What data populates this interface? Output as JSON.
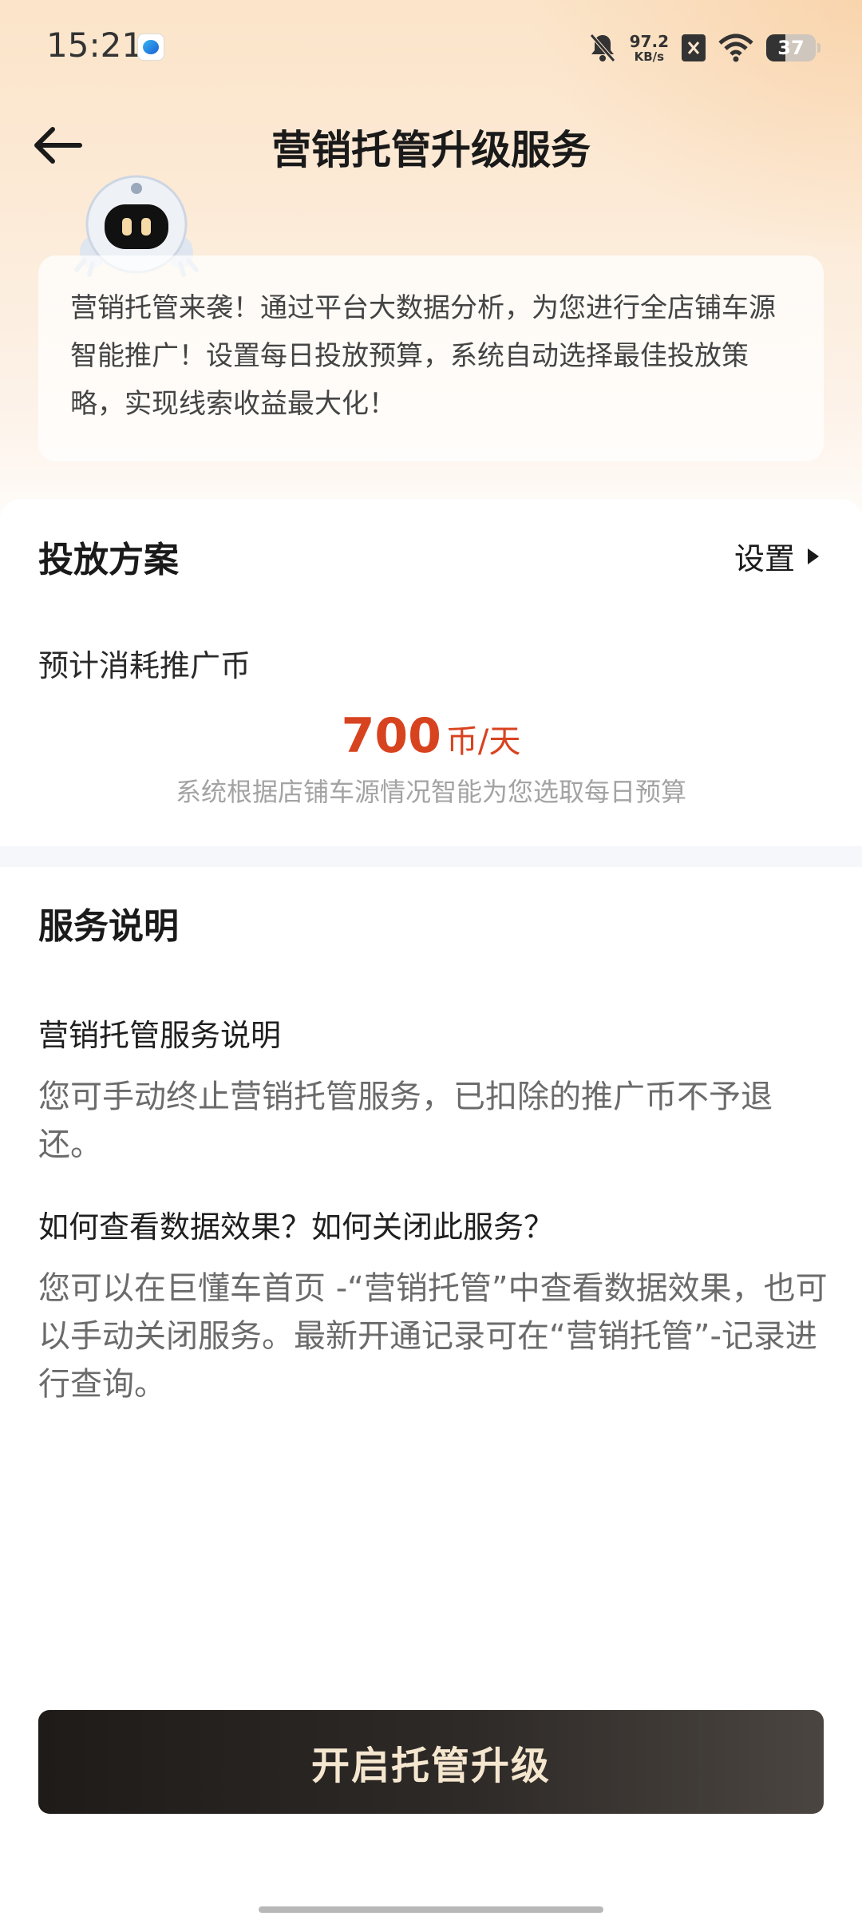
{
  "status_bar": {
    "time": "15:21",
    "net_speed_value": "97.2",
    "net_speed_unit": "KB/s",
    "battery_level": "37",
    "icons": [
      "app-notification-icon",
      "bell-muted-icon",
      "close-x-icon",
      "wifi-icon",
      "battery-icon"
    ]
  },
  "header": {
    "title": "营销托管升级服务",
    "back_icon": "arrow-left-icon"
  },
  "intro": {
    "text": "营销托管来袭！通过平台大数据分析，为您进行全店铺车源智能推广！设置每日投放预算，系统自动选择最佳投放策略，实现线索收益最大化！"
  },
  "plan": {
    "title": "投放方案",
    "settings_label": "设置",
    "estimate_label": "预计消耗推广币",
    "price_value": "700",
    "price_unit": "币/天",
    "price_note": "系统根据店铺车源情况智能为您选取每日预算"
  },
  "service": {
    "title": "服务说明",
    "faqs": [
      {
        "question": "营销托管服务说明",
        "answer": "您可手动终止营销托管服务，已扣除的推广币不予退还。"
      },
      {
        "question": "如何查看数据效果？如何关闭此服务？",
        "answer": "您可以在巨懂车首页 -“营销托管”中查看数据效果，也可以手动关闭服务。最新开通记录可在“营销托管”-记录进行查询。"
      }
    ]
  },
  "cta": {
    "label": "开启托管升级"
  },
  "colors": {
    "accent_price": "#d8431f",
    "cta_background": "#2a2623",
    "cta_text": "#f5e6cf",
    "header_gradient": "#fbe4c9"
  }
}
